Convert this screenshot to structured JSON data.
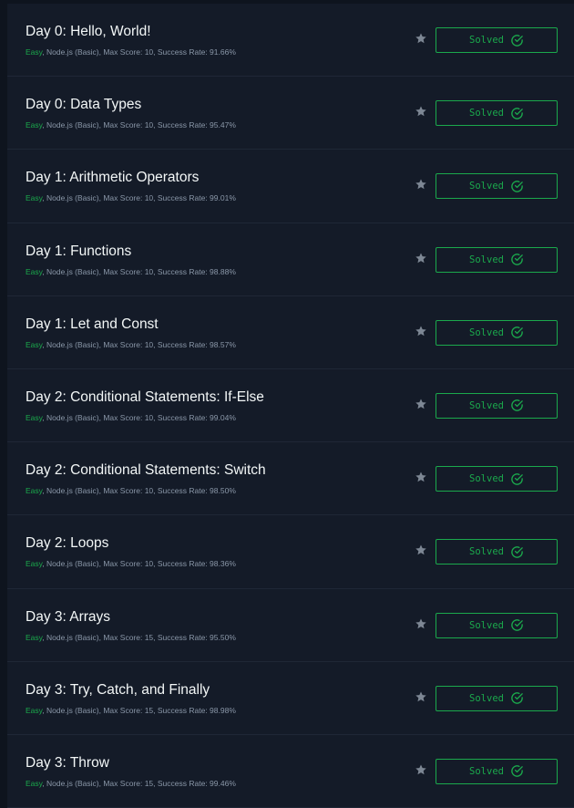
{
  "accent_color": "#1ba94c",
  "challenges": [
    {
      "title": "Day 0: Hello, World!",
      "difficulty": "Easy",
      "details": ", Node.js (Basic), Max Score: 10, Success Rate: 91.66%",
      "status": "Solved"
    },
    {
      "title": "Day 0: Data Types",
      "difficulty": "Easy",
      "details": ", Node.js (Basic), Max Score: 10, Success Rate: 95.47%",
      "status": "Solved"
    },
    {
      "title": "Day 1: Arithmetic Operators",
      "difficulty": "Easy",
      "details": ", Node.js (Basic), Max Score: 10, Success Rate: 99.01%",
      "status": "Solved"
    },
    {
      "title": "Day 1: Functions",
      "difficulty": "Easy",
      "details": ", Node.js (Basic), Max Score: 10, Success Rate: 98.88%",
      "status": "Solved"
    },
    {
      "title": "Day 1: Let and Const",
      "difficulty": "Easy",
      "details": ", Node.js (Basic), Max Score: 10, Success Rate: 98.57%",
      "status": "Solved"
    },
    {
      "title": "Day 2: Conditional Statements: If-Else",
      "difficulty": "Easy",
      "details": ", Node.js (Basic), Max Score: 10, Success Rate: 99.04%",
      "status": "Solved"
    },
    {
      "title": "Day 2: Conditional Statements: Switch",
      "difficulty": "Easy",
      "details": ", Node.js (Basic), Max Score: 10, Success Rate: 98.50%",
      "status": "Solved"
    },
    {
      "title": "Day 2: Loops",
      "difficulty": "Easy",
      "details": ", Node.js (Basic), Max Score: 10, Success Rate: 98.36%",
      "status": "Solved"
    },
    {
      "title": "Day 3: Arrays",
      "difficulty": "Easy",
      "details": ", Node.js (Basic), Max Score: 15, Success Rate: 95.50%",
      "status": "Solved"
    },
    {
      "title": "Day 3: Try, Catch, and Finally",
      "difficulty": "Easy",
      "details": ", Node.js (Basic), Max Score: 15, Success Rate: 98.98%",
      "status": "Solved"
    },
    {
      "title": "Day 3: Throw",
      "difficulty": "Easy",
      "details": ", Node.js (Basic), Max Score: 15, Success Rate: 99.46%",
      "status": "Solved"
    }
  ]
}
